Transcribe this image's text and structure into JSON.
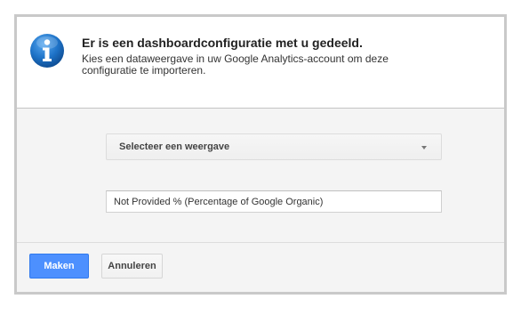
{
  "dialog": {
    "title": "Er is een dashboardconfiguratie met u gedeeld.",
    "description": "Kies een dataweergave in uw Google Analytics-account om deze configuratie te importeren.",
    "icon": "info-icon"
  },
  "body": {
    "view_select": {
      "selected": "Selecteer een weergave",
      "icon": "chevron-down-icon"
    },
    "config_input": {
      "value": "Not Provided % (Percentage of Google Organic)"
    }
  },
  "footer": {
    "create_label": "Maken",
    "cancel_label": "Annuleren"
  },
  "colors": {
    "primary": "#4d90fe",
    "info_icon": "#1e73c8"
  }
}
